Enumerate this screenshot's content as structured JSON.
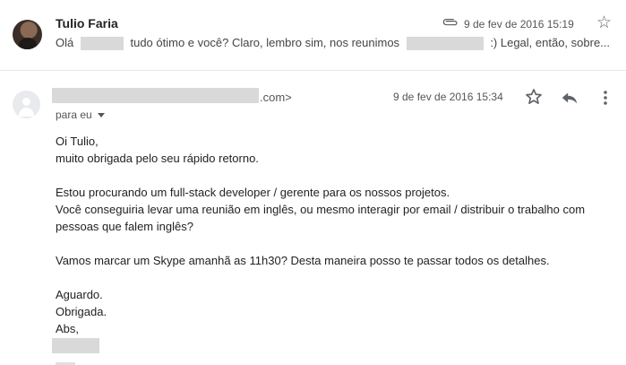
{
  "message1": {
    "sender": "Tulio Faria",
    "date": "9 de fev de 2016 15:19",
    "snippet": {
      "part1": "Olá",
      "part2": "tudo ótimo e você? Claro, lembro sim, nos reunimos",
      "part3": ":) Legal, então, sobre..."
    },
    "icons": [
      "avatar-photo",
      "paperclip-icon",
      "star-outline-icon"
    ]
  },
  "message2": {
    "from_suffix": ".com>",
    "date": "9 de fev de 2016 15:34",
    "recipient": "para eu",
    "icons": [
      "avatar-placeholder",
      "star-outline-icon",
      "reply-icon",
      "more-vert-icon",
      "caret-down-icon"
    ],
    "body": {
      "p1": [
        "Oi Tulio,",
        "muito obrigada pelo seu rápido retorno."
      ],
      "p2": [
        "Estou procurando um full-stack developer / gerente para os nossos  projetos.",
        "Você conseguiria levar uma reunião em inglês, ou mesmo interagir por email / distribuir o trabalho com",
        "pessoas que falem inglês?"
      ],
      "p3": [
        "Vamos marcar um Skype amanhã as 11h30? Desta maneira posso te passar todos os detalhes."
      ],
      "p4": [
        "Aguardo.",
        "Obrigada.",
        "Abs,"
      ]
    }
  },
  "colors": {
    "text": "#222222",
    "muted": "#555555",
    "redaction": "#d9d9d9",
    "icon": "#5f6368"
  }
}
